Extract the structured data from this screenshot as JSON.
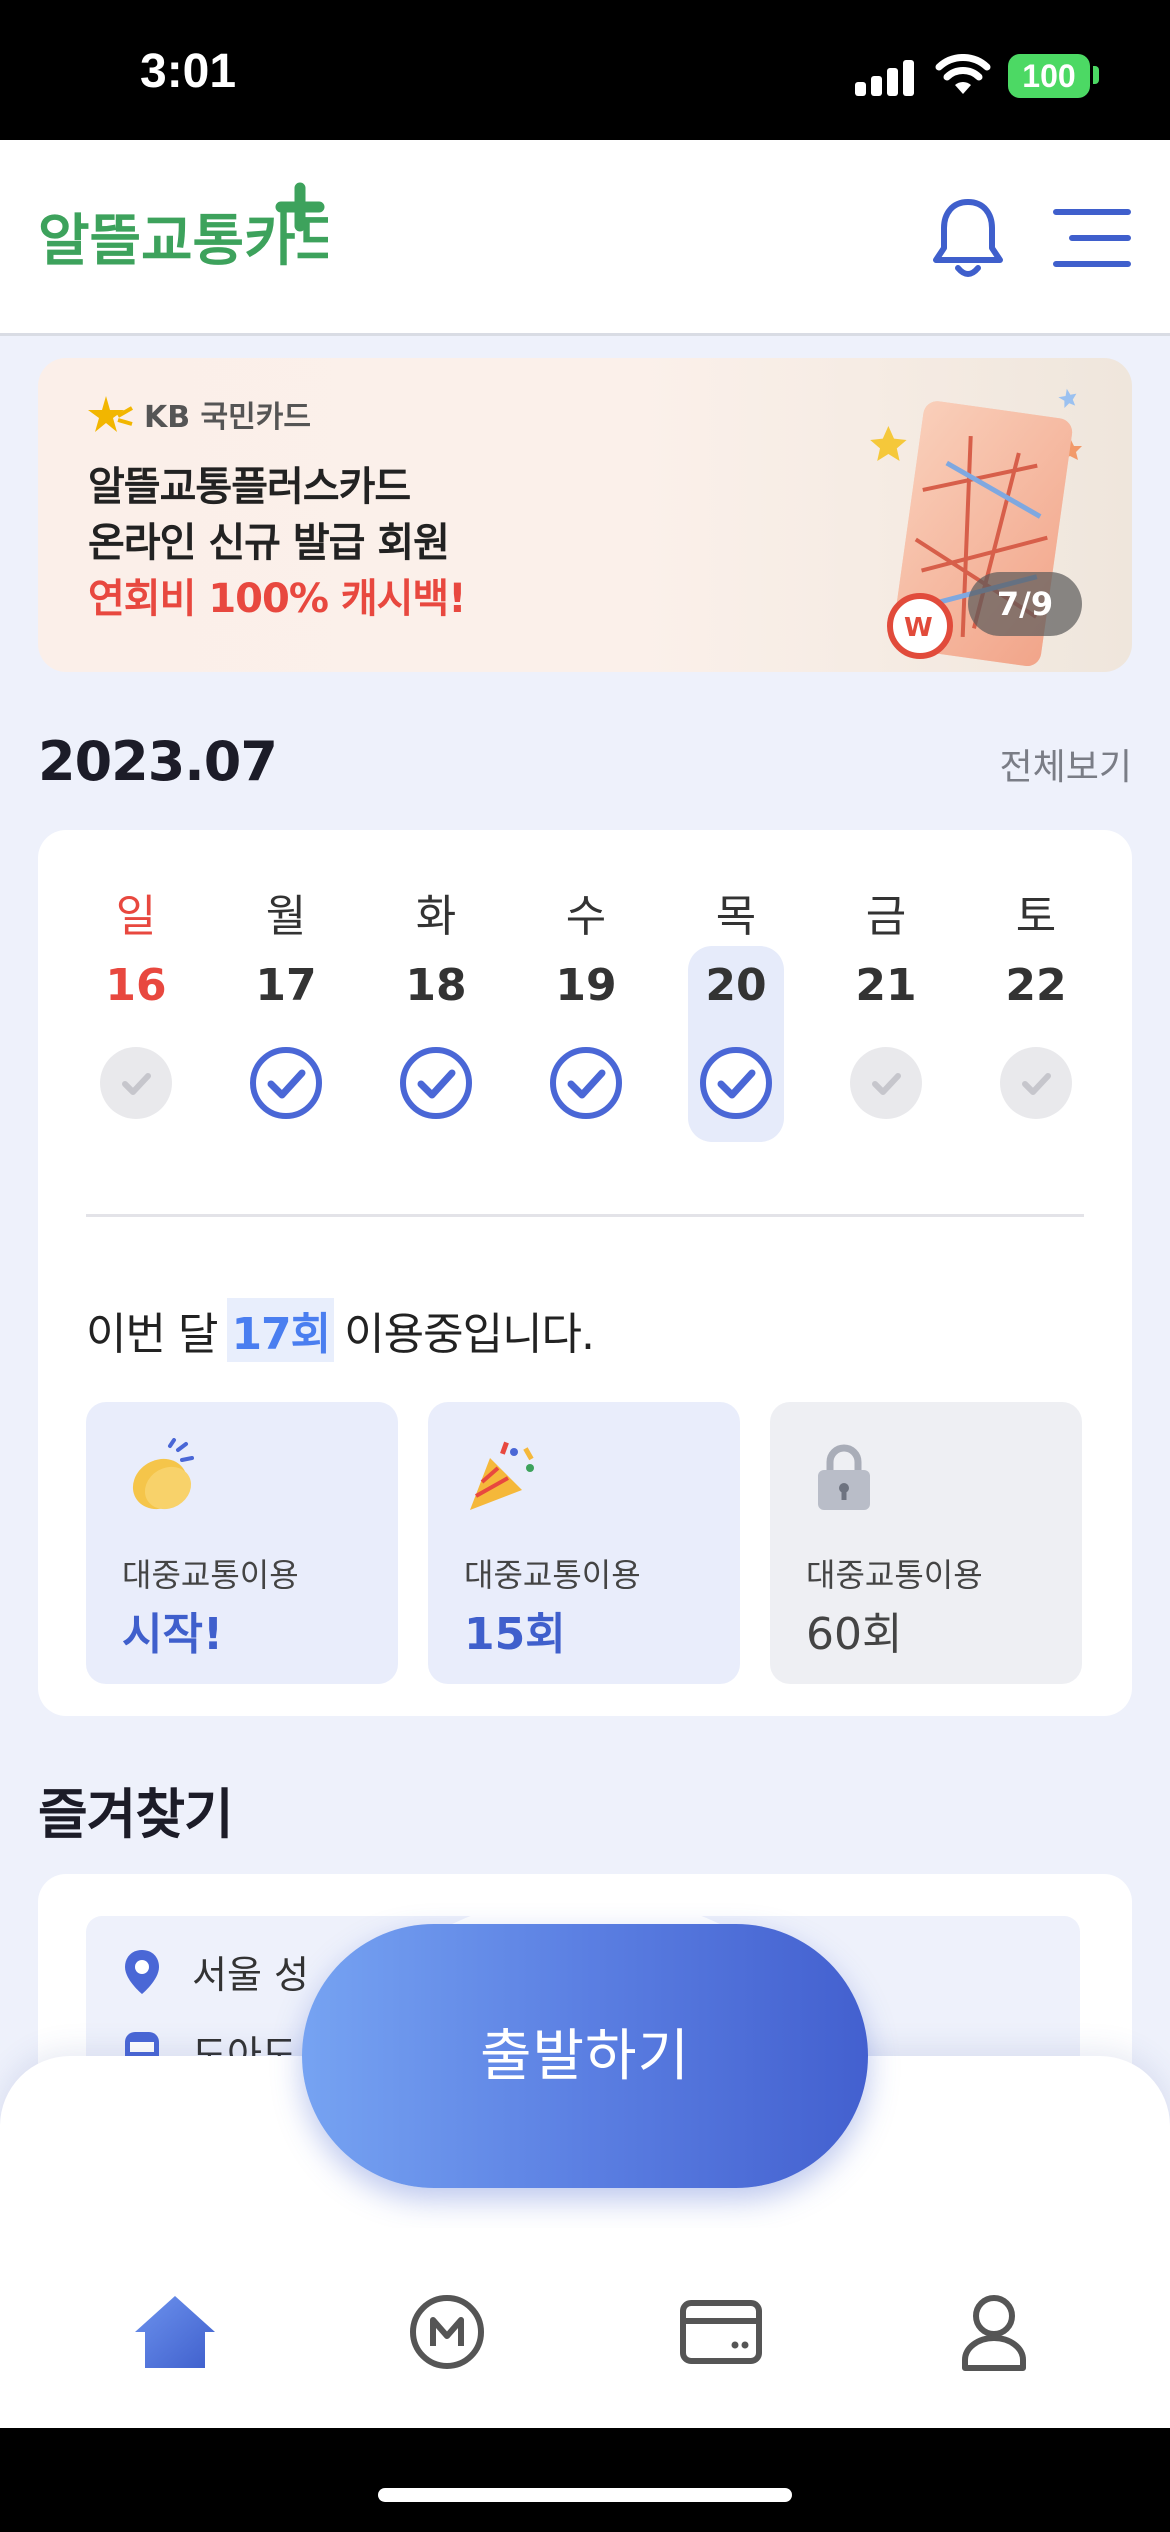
{
  "status_bar": {
    "time": "3:01",
    "battery": "100"
  },
  "header": {
    "logo_text": "알뜰교통카드",
    "notification_icon": "bell-icon",
    "menu_icon": "menu-icon"
  },
  "banner": {
    "brand": "KB 국민카드",
    "line1": "알뜰교통플러스카드",
    "line2": "온라인 신규 발급 회원",
    "line3": "연회비 100% 캐시백!",
    "counter": "7/9"
  },
  "calendar": {
    "month": "2023.07",
    "view_all": "전체보기",
    "days": [
      {
        "weekday": "일",
        "date": "16",
        "checked": false,
        "sunday": true
      },
      {
        "weekday": "월",
        "date": "17",
        "checked": true
      },
      {
        "weekday": "화",
        "date": "18",
        "checked": true
      },
      {
        "weekday": "수",
        "date": "19",
        "checked": true
      },
      {
        "weekday": "목",
        "date": "20",
        "checked": true,
        "today": true
      },
      {
        "weekday": "금",
        "date": "21",
        "checked": false
      },
      {
        "weekday": "토",
        "date": "22",
        "checked": false
      }
    ],
    "usage_prefix": "이번 달",
    "usage_count": "17회",
    "usage_suffix": "이용중입니다.",
    "badges": [
      {
        "label": "대중교통이용",
        "value": "시작!",
        "state": "achieved",
        "icon": "clapping-hands-icon"
      },
      {
        "label": "대중교통이용",
        "value": "15회",
        "state": "achieved",
        "icon": "party-popper-icon"
      },
      {
        "label": "대중교통이용",
        "value": "60회",
        "state": "locked",
        "icon": "lock-icon"
      }
    ]
  },
  "favorites": {
    "title": "즐겨찾기",
    "items": [
      {
        "icon": "location-pin-icon",
        "text": "서울 성"
      },
      {
        "icon": "bus-icon",
        "text": "도아도"
      }
    ]
  },
  "start_button": {
    "label": "출발하기"
  },
  "tabbar": {
    "items": [
      {
        "icon": "home-icon",
        "active": true
      },
      {
        "icon": "mileage-icon",
        "active": false
      },
      {
        "icon": "card-icon",
        "active": false
      },
      {
        "icon": "profile-icon",
        "active": false
      }
    ]
  },
  "colors": {
    "accent": "#4a67d6",
    "sunday": "#e8483f",
    "promo_red": "#e8483f"
  }
}
